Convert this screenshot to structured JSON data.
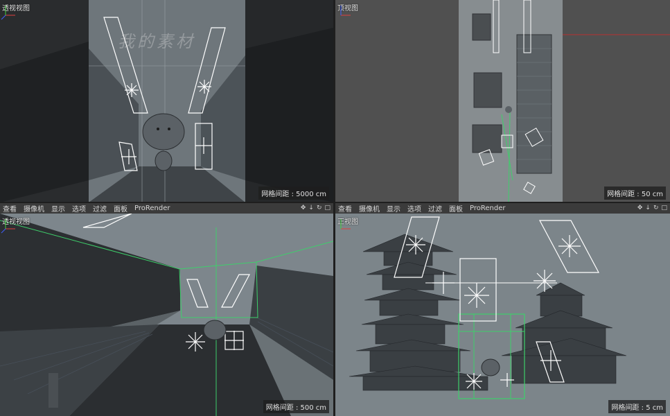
{
  "viewports": {
    "tl": {
      "title": "透视视图",
      "grid": "网格间距 : 5000 cm"
    },
    "tr": {
      "title": "顶视图",
      "grid": "网格间距 : 50 cm"
    },
    "bl": {
      "title": "透视视图",
      "grid": "网格间距 : 500 cm"
    },
    "br": {
      "title": "正视图",
      "grid": "网格间距 : 5 cm"
    }
  },
  "menu": [
    "查看",
    "摄像机",
    "显示",
    "选项",
    "过滤",
    "面板",
    "ProRender"
  ],
  "watermark": "我的素材",
  "colors": {
    "bg_viewport": "#7b848a",
    "grid_green": "#3ecf6b",
    "light_white": "#ffffff"
  },
  "icons": [
    "move-icon",
    "arrow-down-icon",
    "rotate-icon",
    "maximize-icon"
  ]
}
